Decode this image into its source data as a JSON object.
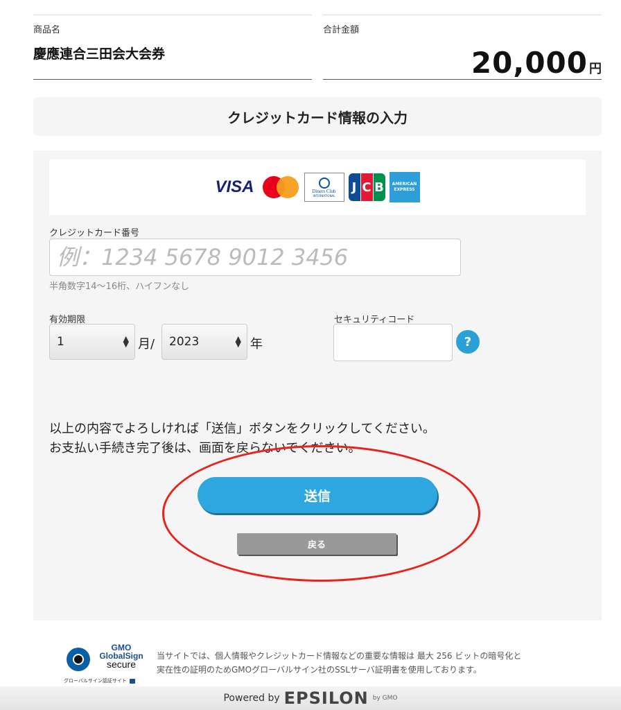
{
  "order": {
    "product_label": "商品名",
    "product_name": "慶應連合三田会大会券",
    "total_label": "合計金額",
    "total_amount": "20,000",
    "currency": "円"
  },
  "section_title": "クレジットカード情報の入力",
  "card_brands": [
    "VISA",
    "Mastercard",
    "Diners Club",
    "JCB",
    "American Express"
  ],
  "brand_text": {
    "visa": "VISA",
    "diners_main": "Diners Club",
    "diners_sub": "INTERNATIONAL",
    "amex": "AMERICAN EXPRESS"
  },
  "card_number": {
    "label": "クレジットカード番号",
    "placeholder": "例：1234 5678 9012 3456",
    "value": "",
    "hint": "半角数字14〜16桁、ハイフンなし"
  },
  "expiry": {
    "label": "有効期限",
    "month_value": "1",
    "month_unit": "月/",
    "year_value": "2023",
    "year_unit": "年"
  },
  "security_code": {
    "label": "セキュリティコード",
    "value": "",
    "help": "?"
  },
  "notice": {
    "line1": "以上の内容でよろしければ「送信」ボタンをクリックしてください。",
    "line2": "お支払い手続き完了後は、画面を戻らないでください。"
  },
  "buttons": {
    "send": "送信",
    "back": "戻る"
  },
  "globalsign": {
    "logo_gmo": "GMO",
    "logo_globalsign": "GlobalSign",
    "logo_secure": "secure",
    "logo_caption": "グローバルサイン認証サイト",
    "text_line1": "当サイトでは、個人情報やクレジットカード情報などの重要な情報は 最大 256 ビットの暗号化と",
    "text_line2": "実在性の証明のためGMOグローバルサイン社のSSLサーバ証明書を使用しております。"
  },
  "footer": {
    "powered_by": "Powered by",
    "brand": "EPSILON",
    "by_gmo": "by GMO"
  },
  "colors": {
    "accent": "#2ea7e0",
    "highlight": "#e8231b",
    "panel": "#f5f5f5"
  }
}
